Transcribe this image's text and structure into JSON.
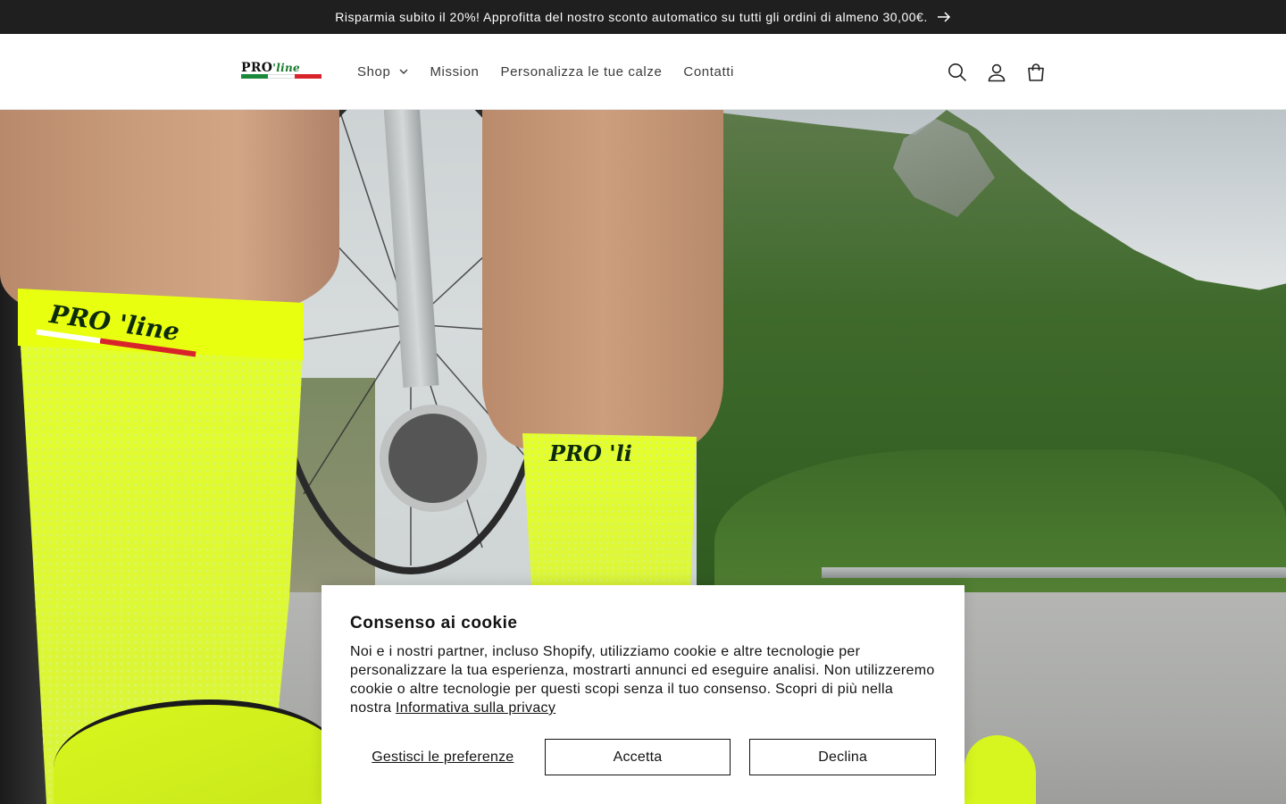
{
  "announcement": {
    "text": "Risparmia subito il 20%! Approfitta del nostro sconto automatico su tutti gli ordini di almeno 30,00€.",
    "icon": "arrow-right-icon"
  },
  "header": {
    "logo": {
      "brand": "PRO",
      "brand_suffix": "'line",
      "flag_colors": [
        "#1a8a3a",
        "#ffffff",
        "#d8232a"
      ]
    },
    "nav": [
      {
        "label": "Shop",
        "has_dropdown": true
      },
      {
        "label": "Mission"
      },
      {
        "label": "Personalizza le tue calze"
      },
      {
        "label": "Contatti"
      }
    ],
    "icons": [
      "search-icon",
      "account-icon",
      "cart-icon"
    ]
  },
  "hero": {
    "sock_brand_left": "PRO 'line",
    "sock_brand_right": "PRO 'li"
  },
  "cookie_banner": {
    "title": "Consenso ai cookie",
    "body": "Noi e i nostri partner, incluso Shopify, utilizziamo cookie e altre tecnologie per personalizzare la tua esperienza, mostrarti annunci ed eseguire analisi. Non utilizzeremo cookie o altre tecnologie per questi scopi senza il tuo consenso. Scopri di più nella nostra ",
    "privacy_link": "Informativa sulla privacy",
    "manage_label": "Gestisci le preferenze",
    "accept_label": "Accetta",
    "decline_label": "Declina"
  },
  "colors": {
    "announcement_bg": "#1f1f1f",
    "text": "#121212",
    "sock_yellow": "#e4ff2a"
  }
}
